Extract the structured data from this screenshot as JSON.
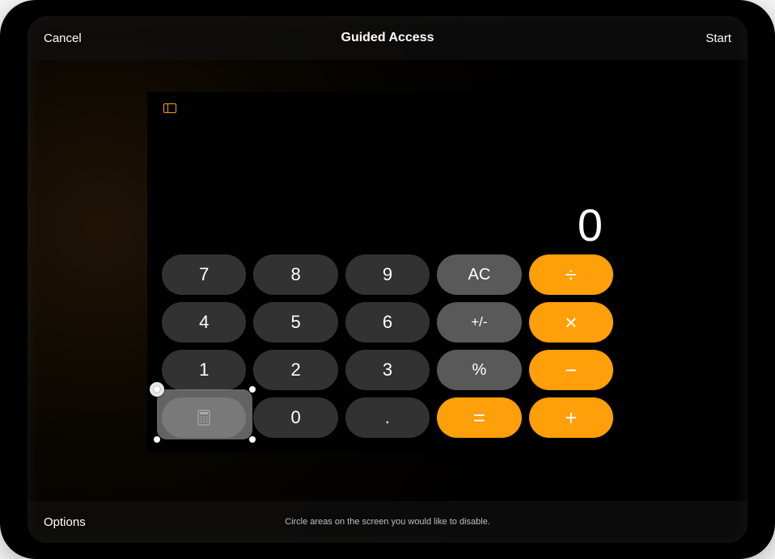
{
  "colors": {
    "operator": "#ff9f0a",
    "number_bg": "#323232",
    "fn_bg": "#595959"
  },
  "navbar": {
    "cancel_label": "Cancel",
    "title": "Guided Access",
    "start_label": "Start"
  },
  "footer": {
    "options_label": "Options",
    "hint": "Circle areas on the screen you would like to disable."
  },
  "calculator": {
    "display_value": "0",
    "keys": {
      "k7": "7",
      "k8": "8",
      "k9": "9",
      "ac": "AC",
      "div": "÷",
      "k4": "4",
      "k5": "5",
      "k6": "6",
      "sign": "+/-",
      "mul": "×",
      "k1": "1",
      "k2": "2",
      "k3": "3",
      "pct": "%",
      "sub": "−",
      "k0": "0",
      "dot": ".",
      "eq": "=",
      "add": "+"
    }
  },
  "mask": {
    "close_glyph": "×"
  }
}
